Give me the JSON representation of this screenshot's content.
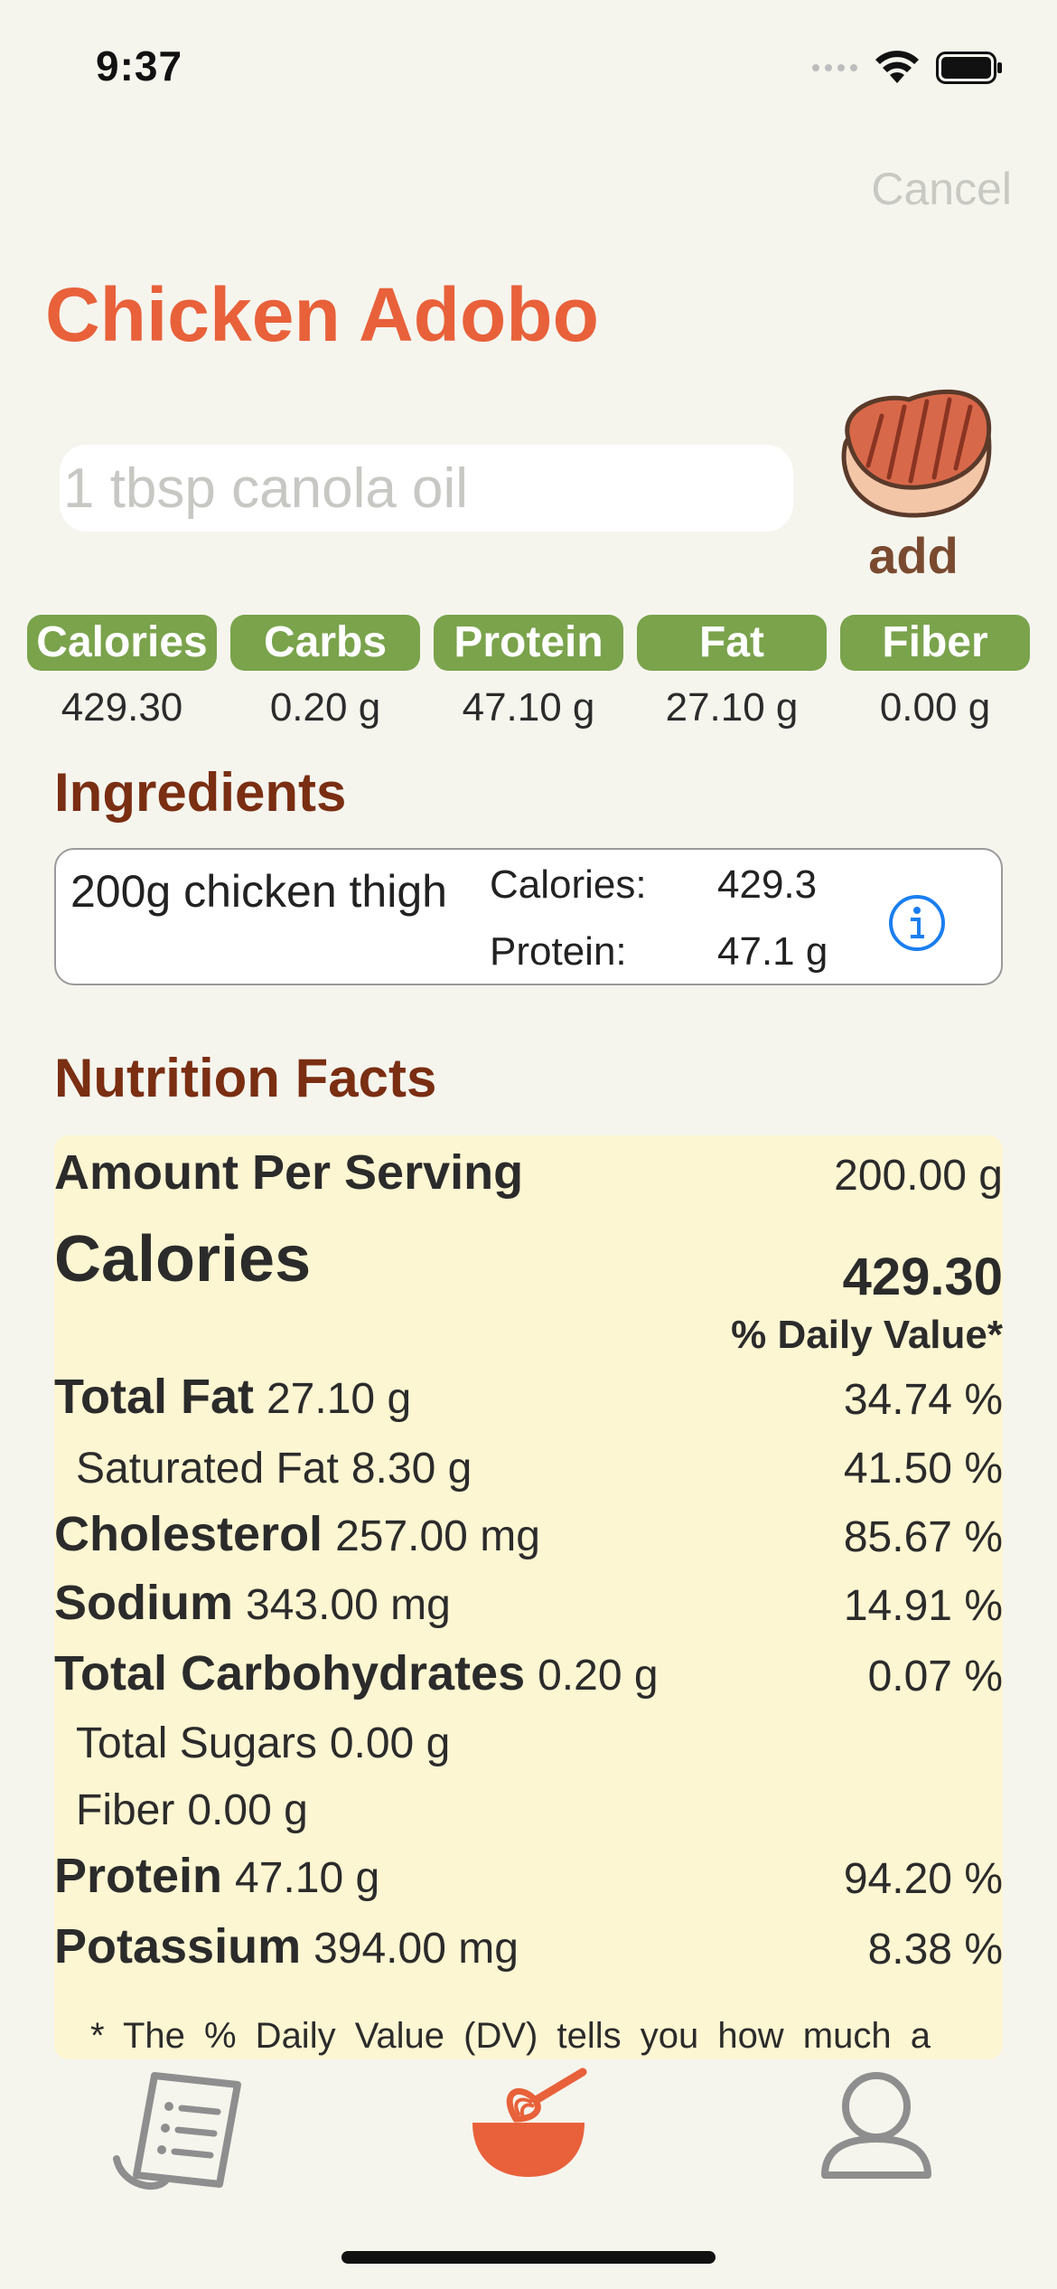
{
  "status": {
    "time": "9:37"
  },
  "header": {
    "cancel_label": "Cancel",
    "title": "Chicken Adobo"
  },
  "input": {
    "placeholder": "1 tbsp canola oil",
    "value": ""
  },
  "add_button": {
    "label": "add"
  },
  "macros": [
    {
      "label": "Calories",
      "value": "429.30"
    },
    {
      "label": "Carbs",
      "value": "0.20 g"
    },
    {
      "label": "Protein",
      "value": "47.10 g"
    },
    {
      "label": "Fat",
      "value": "27.10 g"
    },
    {
      "label": "Fiber",
      "value": "0.00 g"
    }
  ],
  "ingredients": {
    "heading": "Ingredients",
    "items": [
      {
        "name": "200g chicken thigh",
        "k1": "Calories:",
        "v1": "429.3",
        "k2": "Protein:",
        "v2": "47.1 g"
      }
    ]
  },
  "nutrition": {
    "heading": "Nutrition Facts",
    "serving_label": "Amount Per Serving",
    "serving_value": "200.00 g",
    "calories_label": "Calories",
    "calories_value": "429.30",
    "dv_header": "% Daily Value*",
    "rows": [
      {
        "label": "Total Fat",
        "amount": "27.10 g",
        "pct": "34.74 %"
      },
      {
        "label": "Saturated Fat",
        "amount": "8.30 g",
        "pct": "41.50 %"
      },
      {
        "label": "Cholesterol",
        "amount": "257.00 mg",
        "pct": "85.67 %"
      },
      {
        "label": "Sodium",
        "amount": "343.00 mg",
        "pct": "14.91 %"
      },
      {
        "label": "Total Carbohydrates",
        "amount": "0.20 g",
        "pct": "0.07 %"
      },
      {
        "label": "Total Sugars",
        "amount": "0.00 g",
        "pct": ""
      },
      {
        "label": "Fiber",
        "amount": "0.00 g",
        "pct": ""
      },
      {
        "label": "Protein",
        "amount": "47.10 g",
        "pct": "94.20 %"
      },
      {
        "label": "Potassium",
        "amount": "394.00 mg",
        "pct": "8.38 %"
      }
    ],
    "footnote": "* The % Daily Value (DV) tells you how much a"
  },
  "tabs": [
    {
      "icon": "recipe-list-icon"
    },
    {
      "icon": "whisk-bowl-icon",
      "active_color": "#e8613a"
    },
    {
      "icon": "profile-icon"
    }
  ],
  "colors": {
    "accent": "#e8613a",
    "macro_green": "#7aa34c",
    "heading_brown": "#7a2e12",
    "facts_bg": "#fdf6d2"
  }
}
